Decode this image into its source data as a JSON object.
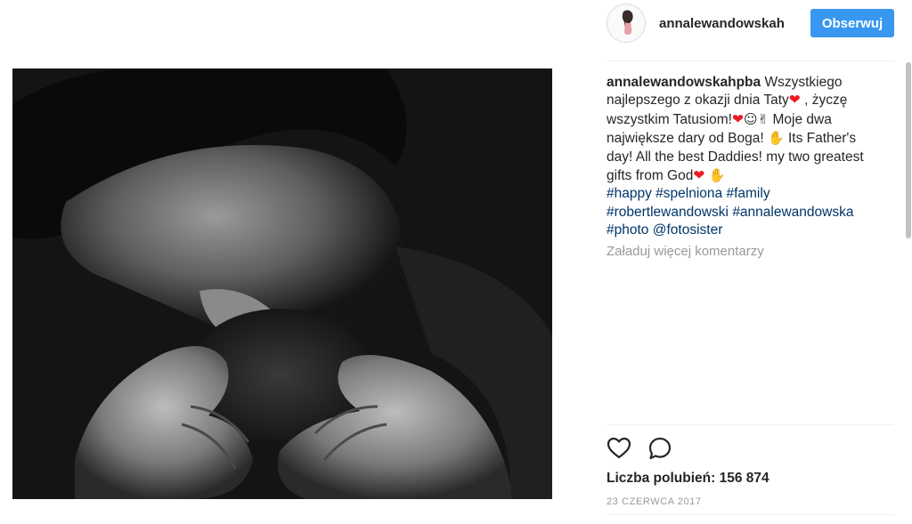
{
  "post": {
    "author": "annalewandowskah",
    "follow_label": "Obserwuj",
    "caption": {
      "username": "annalewandowskahpba",
      "t1": "Wszystkiego najlepszego z okazji dnia Taty",
      "t2": ", życzę wszystkim Tatusiom!",
      "t3": "Moje dwa największe dary od Boga!",
      "t4": "Its Father's day! All the best Daddies! my two greatest gifts from God",
      "hashtags": [
        "#happy",
        "#spelniona",
        "#family",
        "#robertlewandowski",
        "#annalewandowska",
        "#photo"
      ],
      "mention": "@fotosister"
    },
    "load_more": "Załaduj więcej komentarzy",
    "likes": "Liczba polubień: 156 874",
    "date": "23 CZERWCA 2017"
  },
  "icons": {
    "avatar": "profile-avatar-icon",
    "like": "heart-icon",
    "comment": "comment-bubble-icon",
    "heart_emoji": "red-heart-emoji",
    "baby_emoji": "baby-emoji",
    "praise_emoji": "raised-hands-emoji",
    "pray_emoji": "folded-hands-emoji"
  },
  "colors": {
    "accent": "#3897f0",
    "link": "#003569",
    "muted": "#999999",
    "text": "#262626"
  }
}
